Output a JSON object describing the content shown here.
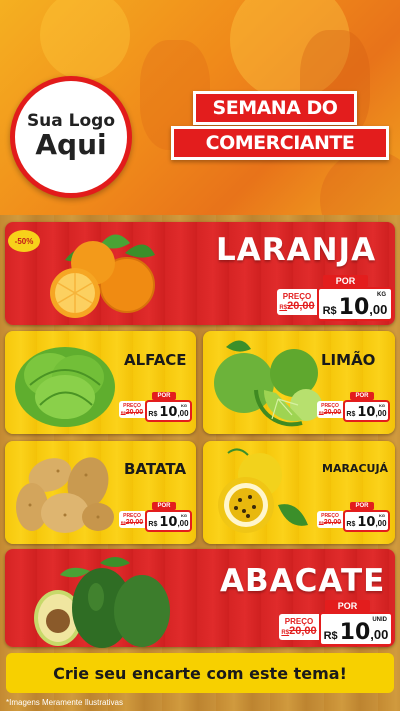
{
  "header": {
    "logo_line1": "Sua Logo",
    "logo_line2": "Aqui",
    "title_line1": "SEMANA DO",
    "title_line2": "COMERCIANTE"
  },
  "discount_badge": "-50%",
  "products": {
    "laranja": {
      "name": "LARANJA",
      "por": "POR",
      "preco": "PREÇO",
      "old_prefix": "R$",
      "old_value": "20,00",
      "currency": "R$",
      "int": "10",
      "dec": ",00",
      "unit": "KG"
    },
    "alface": {
      "name": "ALFACE",
      "por": "POR",
      "preco": "PREÇO",
      "old_prefix": "R$",
      "old_value": "20,00",
      "currency": "R$",
      "int": "10",
      "dec": ",00",
      "unit": "KG"
    },
    "limao": {
      "name": "LIMÃO",
      "por": "POR",
      "preco": "PREÇO",
      "old_prefix": "R$",
      "old_value": "20,00",
      "currency": "R$",
      "int": "10",
      "dec": ",00",
      "unit": "KG"
    },
    "batata": {
      "name": "BATATA",
      "por": "POR",
      "preco": "PREÇO",
      "old_prefix": "R$",
      "old_value": "20,00",
      "currency": "R$",
      "int": "10",
      "dec": ",00",
      "unit": "KG"
    },
    "maracuja": {
      "name": "MARACUJÁ",
      "por": "POR",
      "preco": "PREÇO",
      "old_prefix": "R$",
      "old_value": "20,00",
      "currency": "R$",
      "int": "10",
      "dec": ",00",
      "unit": "KG"
    },
    "abacate": {
      "name": "ABACATE",
      "por": "POR",
      "preco": "PREÇO",
      "old_prefix": "R$",
      "old_value": "20,00",
      "currency": "R$",
      "int": "10",
      "dec": ",00",
      "unit": "UNID"
    }
  },
  "banner": "Crie seu encarte com este tema!",
  "footnote": "*Imagens Meramente Ilustrativas",
  "colors": {
    "red": "#e31d1d",
    "yellow": "#f7d000",
    "orange": "#f08a1a"
  },
  "icons": [
    "orange-fruit-icon",
    "lettuce-icon",
    "lime-icon",
    "potato-icon",
    "passion-fruit-icon",
    "avocado-icon"
  ]
}
